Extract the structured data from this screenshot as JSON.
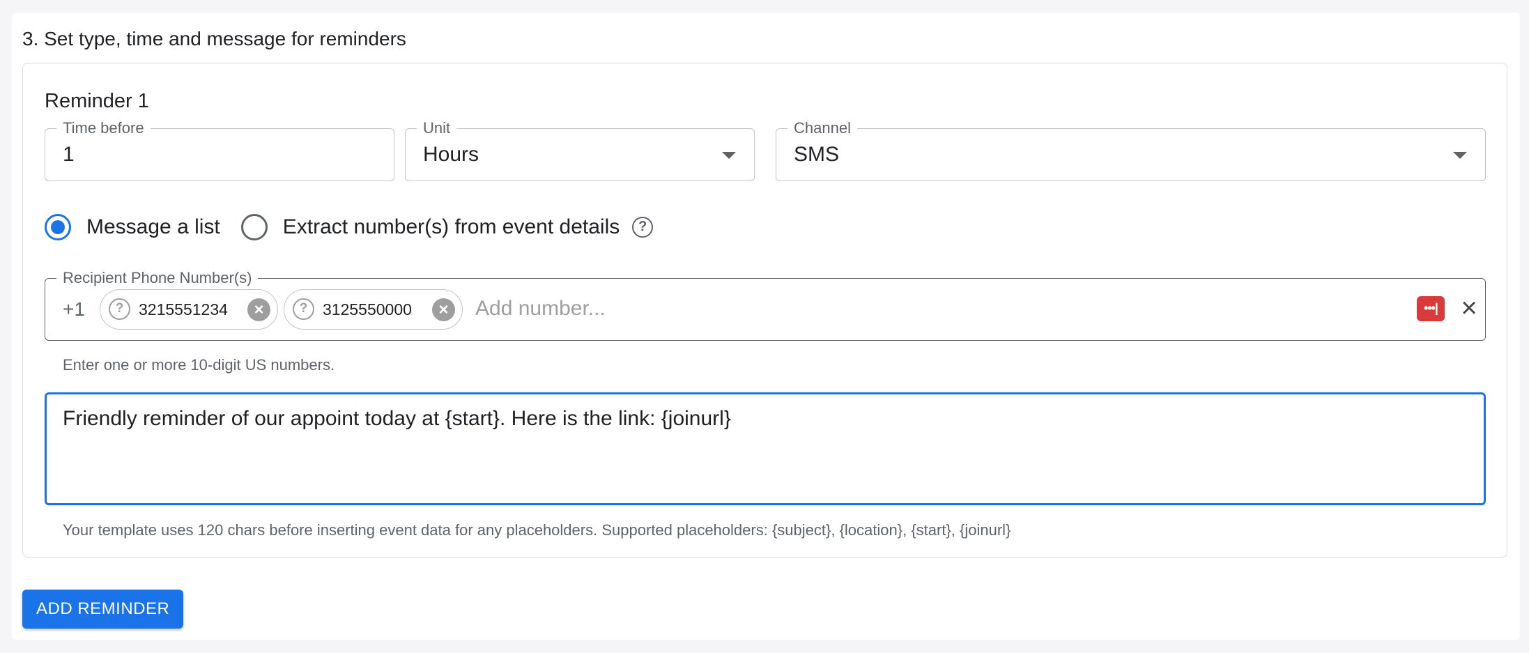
{
  "section": {
    "title": "3. Set type, time and message for reminders"
  },
  "reminder": {
    "title": "Reminder 1",
    "time_before": {
      "label": "Time before",
      "value": "1"
    },
    "unit": {
      "label": "Unit",
      "value": "Hours"
    },
    "channel": {
      "label": "Channel",
      "value": "SMS"
    },
    "radio_options": [
      {
        "label": "Message a list",
        "checked": true
      },
      {
        "label": "Extract number(s) from event details",
        "checked": false
      }
    ],
    "recipients": {
      "label": "Recipient Phone Number(s)",
      "prefix": "+1",
      "chips": [
        "3215551234",
        "3125550000"
      ],
      "placeholder": "Add number...",
      "helper": "Enter one or more 10-digit US numbers."
    },
    "message": {
      "value": "Friendly reminder of our appoint today at {start}. Here is the link: {joinurl}",
      "helper": "Your template uses 120 chars before inserting event data for any placeholders. Supported placeholders: {subject}, {location}, {start}, {joinurl}"
    }
  },
  "actions": {
    "add_reminder": "ADD REMINDER"
  },
  "colors": {
    "accent": "#1a73e8",
    "password_manager": "#d93a3a"
  },
  "icons": {
    "help": "question-circle-icon",
    "chip_delete": "close-circle-icon",
    "clear": "close-icon",
    "password": "password-manager-icon",
    "dropdown": "caret-down-icon"
  }
}
